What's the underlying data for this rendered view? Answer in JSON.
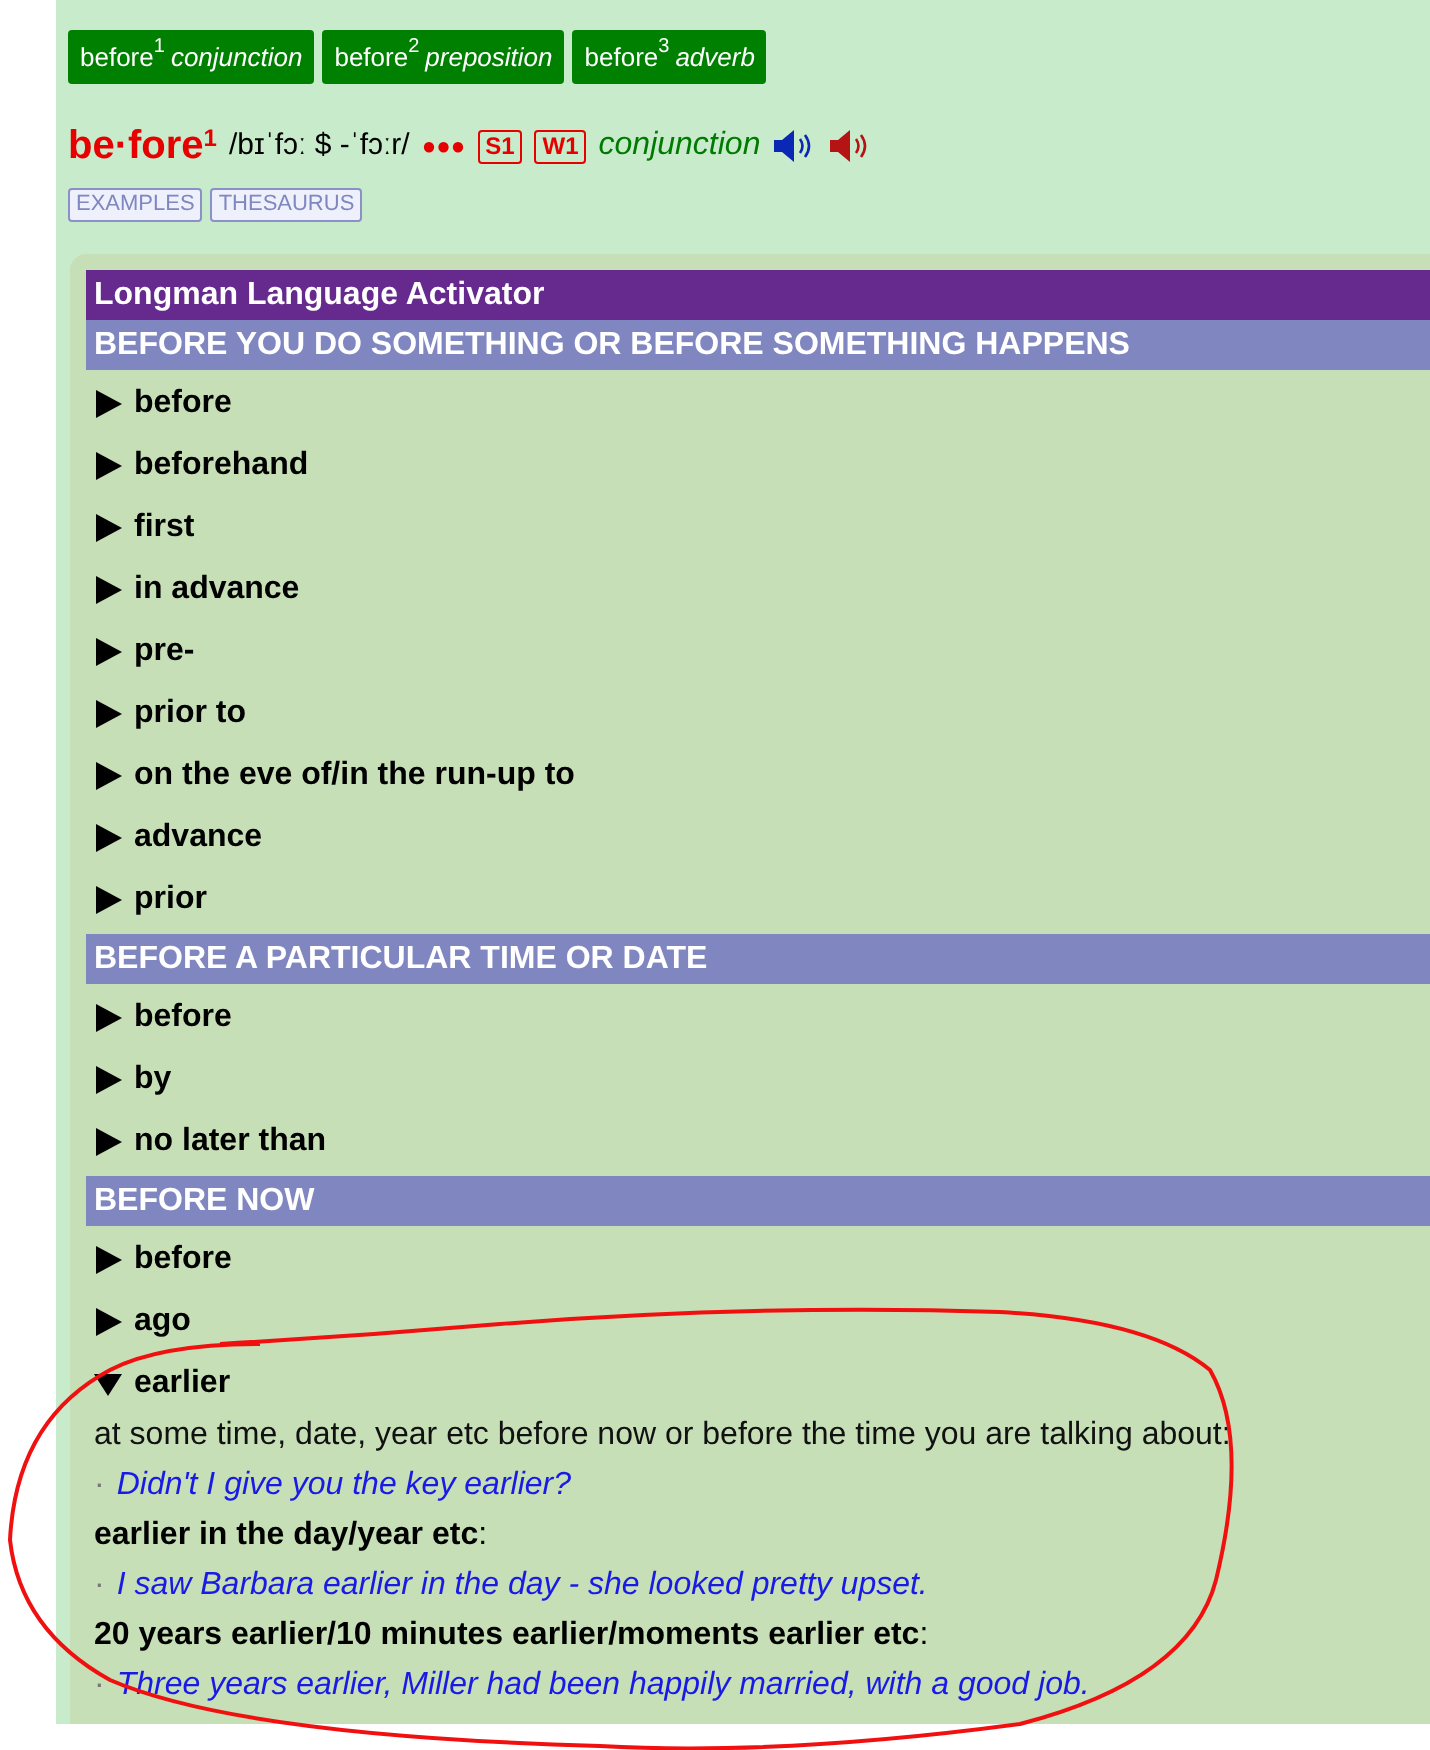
{
  "entry_tabs": [
    {
      "word": "before",
      "homograph": "1",
      "pos": "conjunction"
    },
    {
      "word": "before",
      "homograph": "2",
      "pos": "preposition"
    },
    {
      "word": "before",
      "homograph": "3",
      "pos": "adverb"
    }
  ],
  "headword": {
    "text": "be·fore",
    "homograph": "1",
    "pronunciation": "/bɪˈfɔː $ -ˈfɔːr/",
    "frequency": "●●●",
    "badges": [
      "S1",
      "W1"
    ],
    "pos": "conjunction"
  },
  "buttons": [
    "EXAMPLES",
    "THESAURUS"
  ],
  "activator": {
    "title": "Longman Language Activator",
    "sections": [
      {
        "heading": "BEFORE YOU DO SOMETHING OR BEFORE SOMETHING HAPPENS",
        "items": [
          {
            "label": "before",
            "expanded": false
          },
          {
            "label": "beforehand",
            "expanded": false
          },
          {
            "label": "first",
            "expanded": false
          },
          {
            "label": "in advance",
            "expanded": false
          },
          {
            "label": "pre-",
            "expanded": false
          },
          {
            "label": "prior to",
            "expanded": false
          },
          {
            "label": "on the eve of/in the run-up to",
            "expanded": false
          },
          {
            "label": "advance",
            "expanded": false
          },
          {
            "label": "prior",
            "expanded": false
          }
        ]
      },
      {
        "heading": "BEFORE A PARTICULAR TIME OR DATE",
        "items": [
          {
            "label": "before",
            "expanded": false
          },
          {
            "label": "by",
            "expanded": false
          },
          {
            "label": "no later than",
            "expanded": false
          }
        ]
      },
      {
        "heading": "BEFORE NOW",
        "items": [
          {
            "label": "before",
            "expanded": false
          },
          {
            "label": "ago",
            "expanded": false
          },
          {
            "label": "earlier",
            "expanded": true,
            "senses": [
              {
                "kind": "definition",
                "text": "at some time, date, year etc before now or before the time you are talking about:"
              },
              {
                "kind": "example",
                "bullet": "·",
                "text": "Didn't I give you the key earlier?"
              },
              {
                "kind": "pattern",
                "text": "**earlier in the day/year etc**:"
              },
              {
                "kind": "example",
                "bullet": "·",
                "text": "I saw Barbara earlier in the day - she looked pretty upset."
              },
              {
                "kind": "pattern",
                "text": "**20 years earlier/10 minutes earlier/moments earlier etc**:"
              },
              {
                "kind": "example",
                "bullet": "·",
                "text": "Three years earlier, Miller had been happily married, with a good job."
              }
            ]
          }
        ]
      }
    ]
  }
}
